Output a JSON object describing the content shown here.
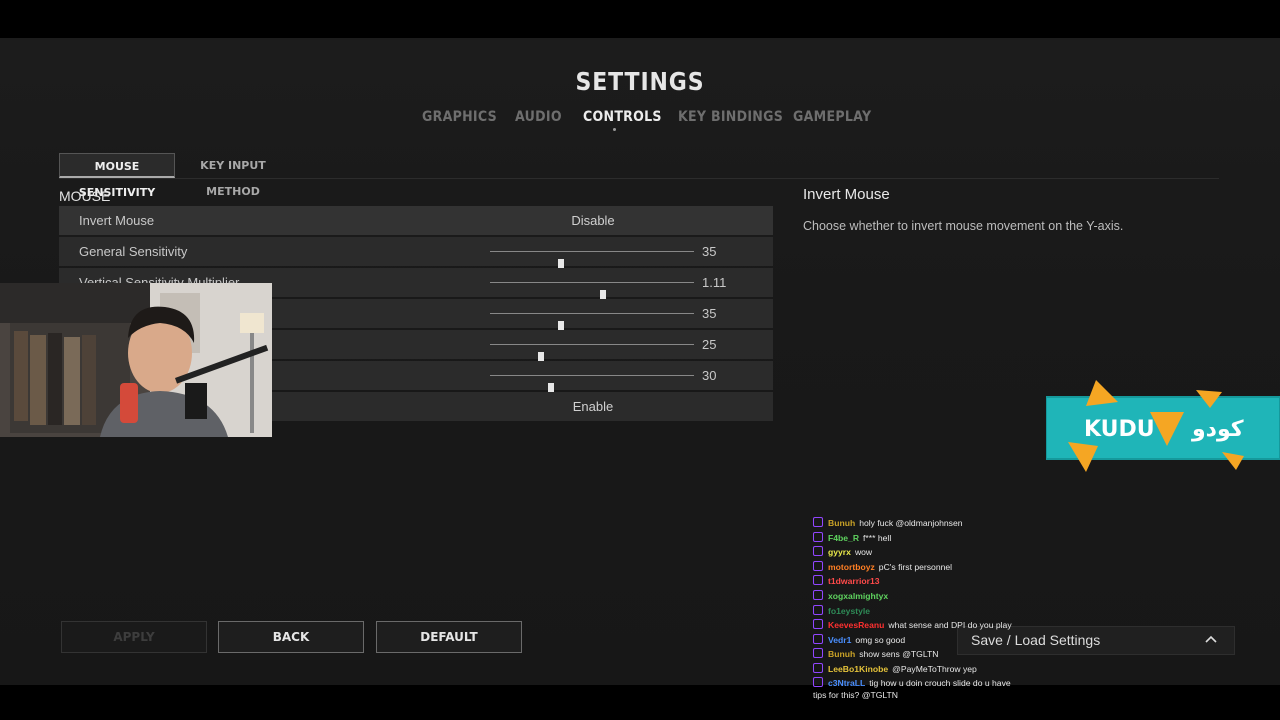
{
  "title": "SETTINGS",
  "tabs": [
    {
      "label": "GRAPHICS",
      "active": false
    },
    {
      "label": "AUDIO",
      "active": false
    },
    {
      "label": "CONTROLS",
      "active": true
    },
    {
      "label": "KEY BINDINGS",
      "active": false
    },
    {
      "label": "GAMEPLAY",
      "active": false
    }
  ],
  "subtabs": [
    {
      "label": "MOUSE SENSITIVITY",
      "active": true
    },
    {
      "label": "KEY INPUT METHOD",
      "active": false
    }
  ],
  "section_title": "MOUSE",
  "rows": [
    {
      "label": "Invert Mouse",
      "type": "option",
      "value": "Disable"
    },
    {
      "label": "General Sensitivity",
      "type": "slider",
      "value": "35",
      "fill": 0.35
    },
    {
      "label": "Vertical Sensitivity Multiplier",
      "type": "slider",
      "value": "1.11",
      "fill": 0.555
    },
    {
      "label": "",
      "type": "slider",
      "value": "35",
      "fill": 0.35
    },
    {
      "label": "",
      "type": "slider",
      "value": "25",
      "fill": 0.25
    },
    {
      "label": "",
      "type": "slider",
      "value": "30",
      "fill": 0.3
    },
    {
      "label": "",
      "type": "option",
      "value": "Enable"
    }
  ],
  "detail": {
    "title": "Invert Mouse",
    "description": "Choose whether to invert mouse movement on the Y-axis."
  },
  "buttons": {
    "apply": "APPLY",
    "back": "BACK",
    "default": "DEFAULT"
  },
  "save_load": {
    "label": "Save / Load Settings"
  },
  "overlay": {
    "sponsor_text": "KUDU",
    "sponsor_arabic": "كودو",
    "sponsor_color": "#1fb5b8",
    "accent_color": "#f5a623"
  },
  "chat": [
    {
      "user": "Bunuh",
      "color": "#c9a227",
      "text": "holy fuck @oldmanjohnsen"
    },
    {
      "user": "F4be_R",
      "color": "#5fd35f",
      "text": "f*** hell"
    },
    {
      "user": "gyyrx",
      "color": "#e8e84a",
      "text": "wow"
    },
    {
      "user": "motortboyz",
      "color": "#ff7f24",
      "text": "pC's first personnel"
    },
    {
      "user": "t1dwarrior13",
      "color": "#ff4a4a",
      "text": ""
    },
    {
      "user": "xogxalmightyx",
      "color": "#5fd35f",
      "text": ""
    },
    {
      "user": "fo1eystyle",
      "color": "#2e8b57",
      "text": ""
    },
    {
      "user": "KeevesReanu",
      "color": "#ff3030",
      "text": "what sense and DPI do you play"
    },
    {
      "user": "Vedr1",
      "color": "#4a8fff",
      "text": "omg so good"
    },
    {
      "user": "Bunuh",
      "color": "#c9a227",
      "text": "show sens @TGLTN"
    },
    {
      "user": "LeeBo1Kinobe",
      "color": "#e5c33a",
      "text": "@PayMeToThrow yep"
    },
    {
      "user": "c3NtraLL",
      "color": "#4a8fff",
      "text": "tig how u doin crouch slide do u have tips for this? @TGLTN"
    }
  ]
}
